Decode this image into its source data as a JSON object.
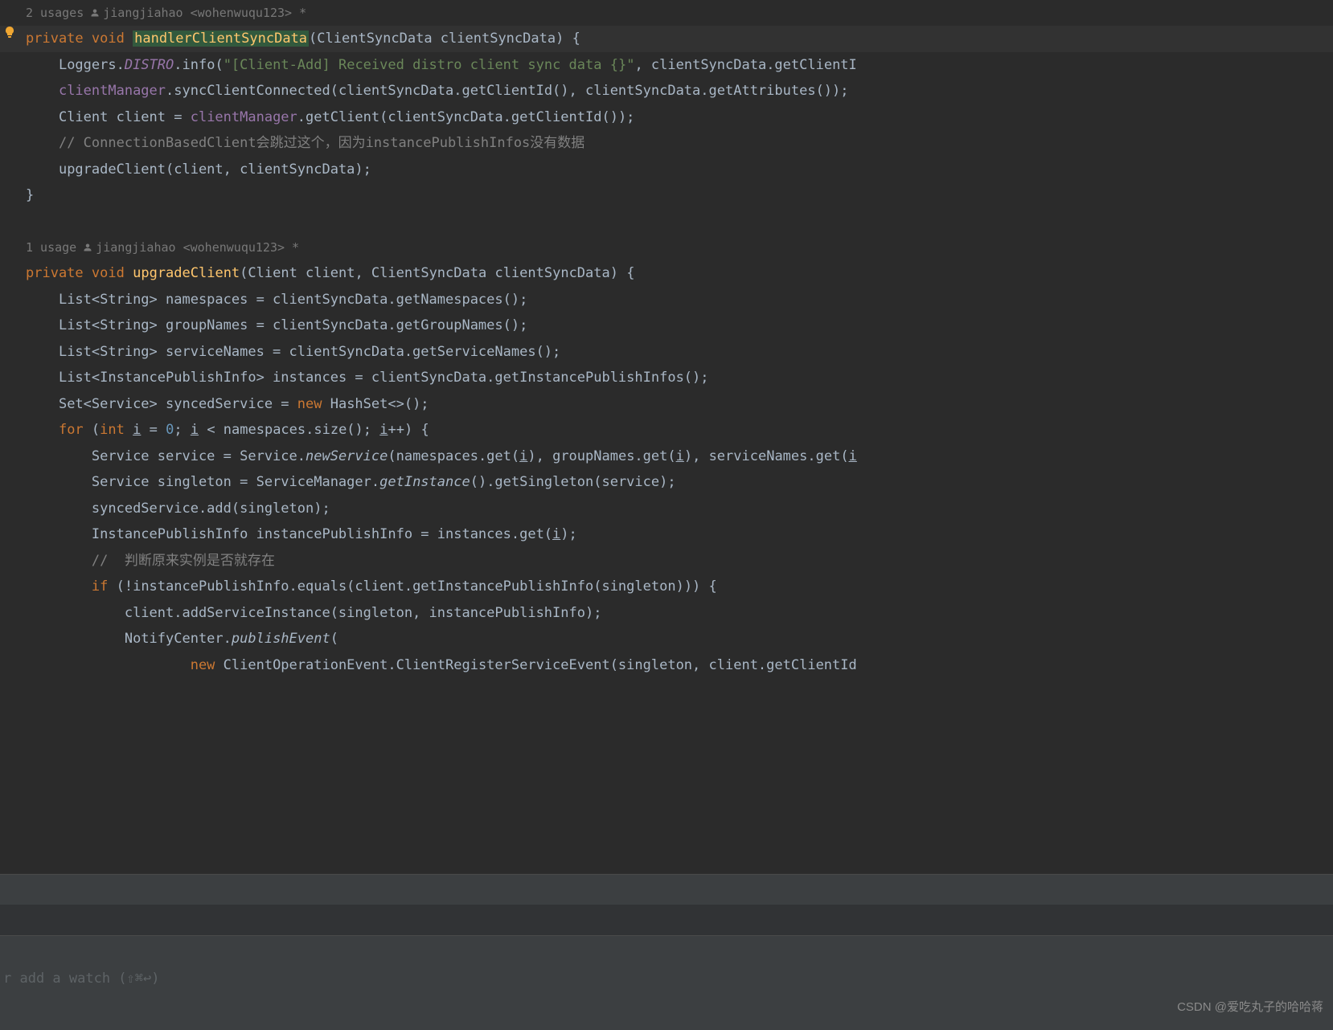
{
  "usages": {
    "first": {
      "count": "2 usages",
      "author": "jiangjiahao <wohenwuqu123> *"
    },
    "second": {
      "count": "1 usage",
      "author": "jiangjiahao <wohenwuqu123> *"
    }
  },
  "code": {
    "m1": {
      "kw_private": "private",
      "kw_void": "void",
      "name": "handlerClientSyncData",
      "params": "(ClientSyncData clientSyncData) {",
      "l1_a": "Loggers.",
      "l1_b": "DISTRO",
      "l1_c": ".info(",
      "l1_d": "\"[Client-Add] Received distro client sync data {}\"",
      "l1_e": ", clientSyncData.getClientI",
      "l2_a": "clientManager",
      "l2_b": ".syncClientConnected(clientSyncData.getClientId(), clientSyncData.getAttributes());",
      "l3_a": "Client client = ",
      "l3_b": "clientManager",
      "l3_c": ".getClient(clientSyncData.getClientId());",
      "l4": "// ConnectionBasedClient会跳过这个，因为instancePublishInfos没有数据",
      "l5_a": "upgradeClient(client, clientSyncData);",
      "l6": "}"
    },
    "m2": {
      "kw_private": "private",
      "kw_void": "void",
      "name": "upgradeClient",
      "params": "(Client client, ClientSyncData clientSyncData) {",
      "l1": "List<String> namespaces = clientSyncData.getNamespaces();",
      "l2": "List<String> groupNames = clientSyncData.getGroupNames();",
      "l3": "List<String> serviceNames = clientSyncData.getServiceNames();",
      "l4": "List<InstancePublishInfo> instances = clientSyncData.getInstancePublishInfos();",
      "l5_a": "Set<Service> syncedService = ",
      "l5_b": "new",
      "l5_c": " HashSet<>();",
      "l6_a": "for",
      "l6_b": " (",
      "l6_c": "int",
      "l6_d": " ",
      "l6_e": "i",
      "l6_f": " = ",
      "l6_g": "0",
      "l6_h": "; ",
      "l6_i": "i",
      "l6_j": " < namespaces.size(); ",
      "l6_k": "i",
      "l6_l": "++) {",
      "l7_a": "Service service = Service.",
      "l7_b": "newService",
      "l7_c": "(namespaces.get(",
      "l7_d": "i",
      "l7_e": "), groupNames.get(",
      "l7_f": "i",
      "l7_g": "), serviceNames.get(",
      "l7_h": "i",
      "l8_a": "Service singleton = ServiceManager.",
      "l8_b": "getInstance",
      "l8_c": "().getSingleton(service);",
      "l9": "syncedService.add(singleton);",
      "l10_a": "InstancePublishInfo instancePublishInfo = instances.get(",
      "l10_b": "i",
      "l10_c": ");",
      "l11": "//  判断原来实例是否就存在",
      "l12_a": "if",
      "l12_b": " (!instancePublishInfo.equals(client.getInstancePublishInfo(singleton))) {",
      "l13": "client.addServiceInstance(singleton, instancePublishInfo);",
      "l14_a": "NotifyCenter.",
      "l14_b": "publishEvent",
      "l14_c": "(",
      "l15_a": "new",
      "l15_b": " ClientOperationEvent.ClientRegisterServiceEvent(singleton, client.getClientId"
    }
  },
  "footer": {
    "watch_hint": "r add a watch (⇧⌘↩)",
    "watermark": "CSDN @爱吃丸子的哈哈蒋"
  }
}
